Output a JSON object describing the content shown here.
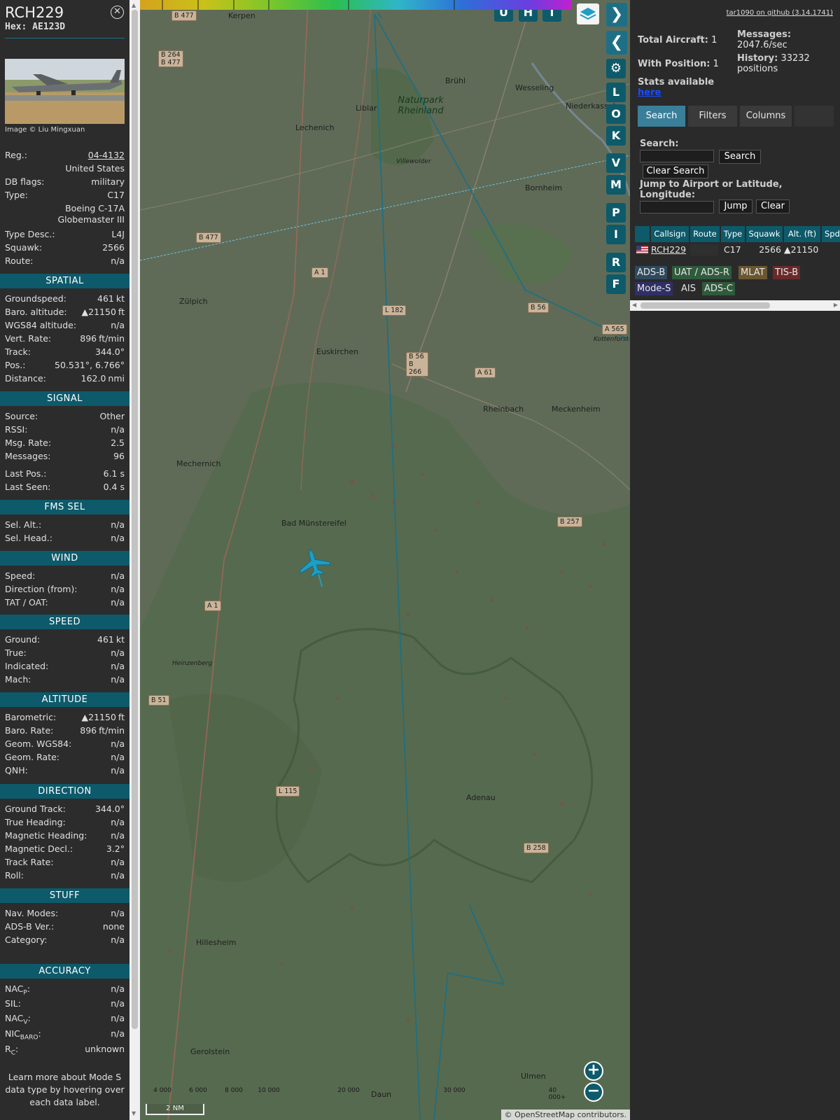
{
  "aircraft": {
    "callsign": "RCH229",
    "hex_label": "Hex:",
    "hex": "AE123D",
    "close_icon": "close-icon",
    "image_credit": "Image © Liu Mingxuan",
    "reg_label": "Reg.:",
    "reg": "04-4132",
    "country": "United States",
    "dbflags_label": "DB flags:",
    "dbflags": "military",
    "type_label": "Type:",
    "type": "C17",
    "model_line1": "Boeing C-17A",
    "model_line2": "Globemaster III",
    "typedesc_label": "Type Desc.:",
    "typedesc": "L4J",
    "squawk_label": "Squawk:",
    "squawk": "2566",
    "route_label": "Route:",
    "route": "n/a"
  },
  "sections": {
    "spatial": "SPATIAL",
    "signal": "SIGNAL",
    "fmssel": "FMS SEL",
    "wind": "WIND",
    "speed": "SPEED",
    "altitude": "ALTITUDE",
    "direction": "DIRECTION",
    "stuff": "STUFF",
    "accuracy": "ACCURACY"
  },
  "spatial": [
    {
      "label": "Groundspeed:",
      "value": "461",
      "unit": "kt"
    },
    {
      "label": "Baro. altitude:",
      "value": "▲21150",
      "unit": "ft"
    },
    {
      "label": "WGS84 altitude:",
      "value": "n/a",
      "unit": ""
    },
    {
      "label": "Vert. Rate:",
      "value": "896",
      "unit": "ft/min"
    },
    {
      "label": "Track:",
      "value": "344.0°",
      "unit": ""
    },
    {
      "label": "Pos.:",
      "value": "50.531°, 6.766°",
      "unit": ""
    },
    {
      "label": "Distance:",
      "value": "162.0",
      "unit": "nmi"
    }
  ],
  "signal": [
    {
      "label": "Source:",
      "value": "Other"
    },
    {
      "label": "RSSI:",
      "value": "n/a"
    },
    {
      "label": "Msg. Rate:",
      "value": "2.5"
    },
    {
      "label": "Messages:",
      "value": "96"
    },
    {
      "label": "Last Pos.:",
      "value": "6.1 s"
    },
    {
      "label": "Last Seen:",
      "value": "0.4 s"
    }
  ],
  "fmssel": [
    {
      "label": "Sel. Alt.:",
      "value": "n/a"
    },
    {
      "label": "Sel. Head.:",
      "value": "n/a"
    }
  ],
  "wind": [
    {
      "label": "Speed:",
      "value": "n/a"
    },
    {
      "label": "Direction (from):",
      "value": "n/a"
    },
    {
      "label": "TAT / OAT:",
      "value": "n/a"
    }
  ],
  "speed": [
    {
      "label": "Ground:",
      "value": "461",
      "unit": "kt"
    },
    {
      "label": "True:",
      "value": "n/a",
      "unit": ""
    },
    {
      "label": "Indicated:",
      "value": "n/a",
      "unit": ""
    },
    {
      "label": "Mach:",
      "value": "n/a",
      "unit": ""
    }
  ],
  "altitude": [
    {
      "label": "Barometric:",
      "value": "▲21150",
      "unit": "ft"
    },
    {
      "label": "Baro. Rate:",
      "value": "896",
      "unit": "ft/min"
    },
    {
      "label": "Geom. WGS84:",
      "value": "n/a",
      "unit": ""
    },
    {
      "label": "Geom. Rate:",
      "value": "n/a",
      "unit": ""
    },
    {
      "label": "QNH:",
      "value": "n/a",
      "unit": ""
    }
  ],
  "direction": [
    {
      "label": "Ground Track:",
      "value": "344.0°"
    },
    {
      "label": "True Heading:",
      "value": "n/a"
    },
    {
      "label": "Magnetic Heading:",
      "value": "n/a"
    },
    {
      "label": "Magnetic Decl.:",
      "value": "3.2°"
    },
    {
      "label": "Track Rate:",
      "value": "n/a"
    },
    {
      "label": "Roll:",
      "value": "n/a"
    }
  ],
  "stuff": [
    {
      "label": "Nav. Modes:",
      "value": "n/a"
    },
    {
      "label": "ADS-B Ver.:",
      "value": "none"
    },
    {
      "label": "Category:",
      "value": "n/a"
    }
  ],
  "accuracy": [
    {
      "label": "NAC",
      "sub": "P",
      "value": "n/a"
    },
    {
      "label": "SIL:",
      "sub": "",
      "value": "n/a"
    },
    {
      "label": "NAC",
      "sub": "V",
      "value": "n/a"
    },
    {
      "label": "NIC",
      "sub": "BARO",
      "value": "n/a"
    },
    {
      "label": "R",
      "sub": "C",
      "value": "unknown"
    }
  ],
  "note": "Learn more about Mode S data type by hovering over each data label.",
  "map": {
    "top_buttons": [
      "U",
      "H",
      "T"
    ],
    "side_buttons": [
      "L",
      "O",
      "K",
      "V",
      "M",
      "P",
      "I",
      "R",
      "F"
    ],
    "places": [
      {
        "name": "Kerpen"
      },
      {
        "name": "Brühl"
      },
      {
        "name": "Wesseling"
      },
      {
        "name": "Niederkassel"
      },
      {
        "name": "Naturpark Rheinland"
      },
      {
        "name": "Liblar"
      },
      {
        "name": "Lechenich"
      },
      {
        "name": "Villewolder"
      },
      {
        "name": "Bornheim"
      },
      {
        "name": "Zülpich"
      },
      {
        "name": "Euskirchen"
      },
      {
        "name": "Rheinbach"
      },
      {
        "name": "Meckenheim"
      },
      {
        "name": "Kottenforst"
      },
      {
        "name": "Mechernich"
      },
      {
        "name": "Bad Münstereifel"
      },
      {
        "name": "Heinzenberg"
      },
      {
        "name": "Adenau"
      },
      {
        "name": "Hillesheim"
      },
      {
        "name": "Gerolstein"
      },
      {
        "name": "Daun"
      },
      {
        "name": "Ulmen"
      }
    ],
    "roads": [
      "B 477",
      "B 264 B 477",
      "B 477",
      "A 1",
      "L 182",
      "B 56",
      "B 56 B 266",
      "A 61",
      "A 565",
      "B 257",
      "A 1",
      "B 51",
      "L 115",
      "B 258"
    ],
    "scale_labels": [
      "4 000",
      "6 000",
      "8 000",
      "10 000",
      "20 000",
      "30 000",
      "40 000+"
    ],
    "scale_nm": "2 NM",
    "osm_credit": "© OpenStreetMap contributors.",
    "zoom_in": "+",
    "zoom_out": "−"
  },
  "stats": {
    "github": "tar1090 on github (3.14.1741)",
    "total_label": "Total Aircraft:",
    "total": "1",
    "withpos_label": "With Position:",
    "withpos": "1",
    "messages_label": "Messages:",
    "messages": "2047.6/sec",
    "history_label": "History:",
    "history": "33232 positions",
    "stats_text": "Stats available",
    "stats_link": "here"
  },
  "tabs": [
    "Search",
    "Filters",
    "Columns"
  ],
  "search": {
    "search_label": "Search:",
    "search_btn": "Search",
    "clear_search_btn": "Clear Search",
    "jump_label": "Jump to Airport or Latitude, Longitude:",
    "jump_btn": "Jump",
    "clear_btn": "Clear"
  },
  "table": {
    "headers": [
      "Callsign",
      "Route",
      "Type",
      "Squawk",
      "Alt. (ft)",
      "Spd"
    ],
    "rows": [
      {
        "callsign": "RCH229",
        "route": "",
        "type": "C17",
        "squawk": "2566",
        "alt": "▲21150"
      }
    ]
  },
  "legend": [
    {
      "label": "ADS-B",
      "bg": "#2e4a5d"
    },
    {
      "label": "UAT / ADS-R",
      "bg": "#2f5a3c"
    },
    {
      "label": "MLAT",
      "bg": "#6a5630"
    },
    {
      "label": "TIS-B",
      "bg": "#6a2a2a"
    },
    {
      "label": "Mode-S",
      "bg": "#2f2f66"
    },
    {
      "label": "AIS",
      "bg": "#2a2a2a"
    },
    {
      "label": "ADS-C",
      "bg": "#2f5a3c"
    }
  ],
  "colors": {
    "accent": "#0d5a6b",
    "track": "#1a6f86",
    "plane": "#1e9ec4"
  }
}
